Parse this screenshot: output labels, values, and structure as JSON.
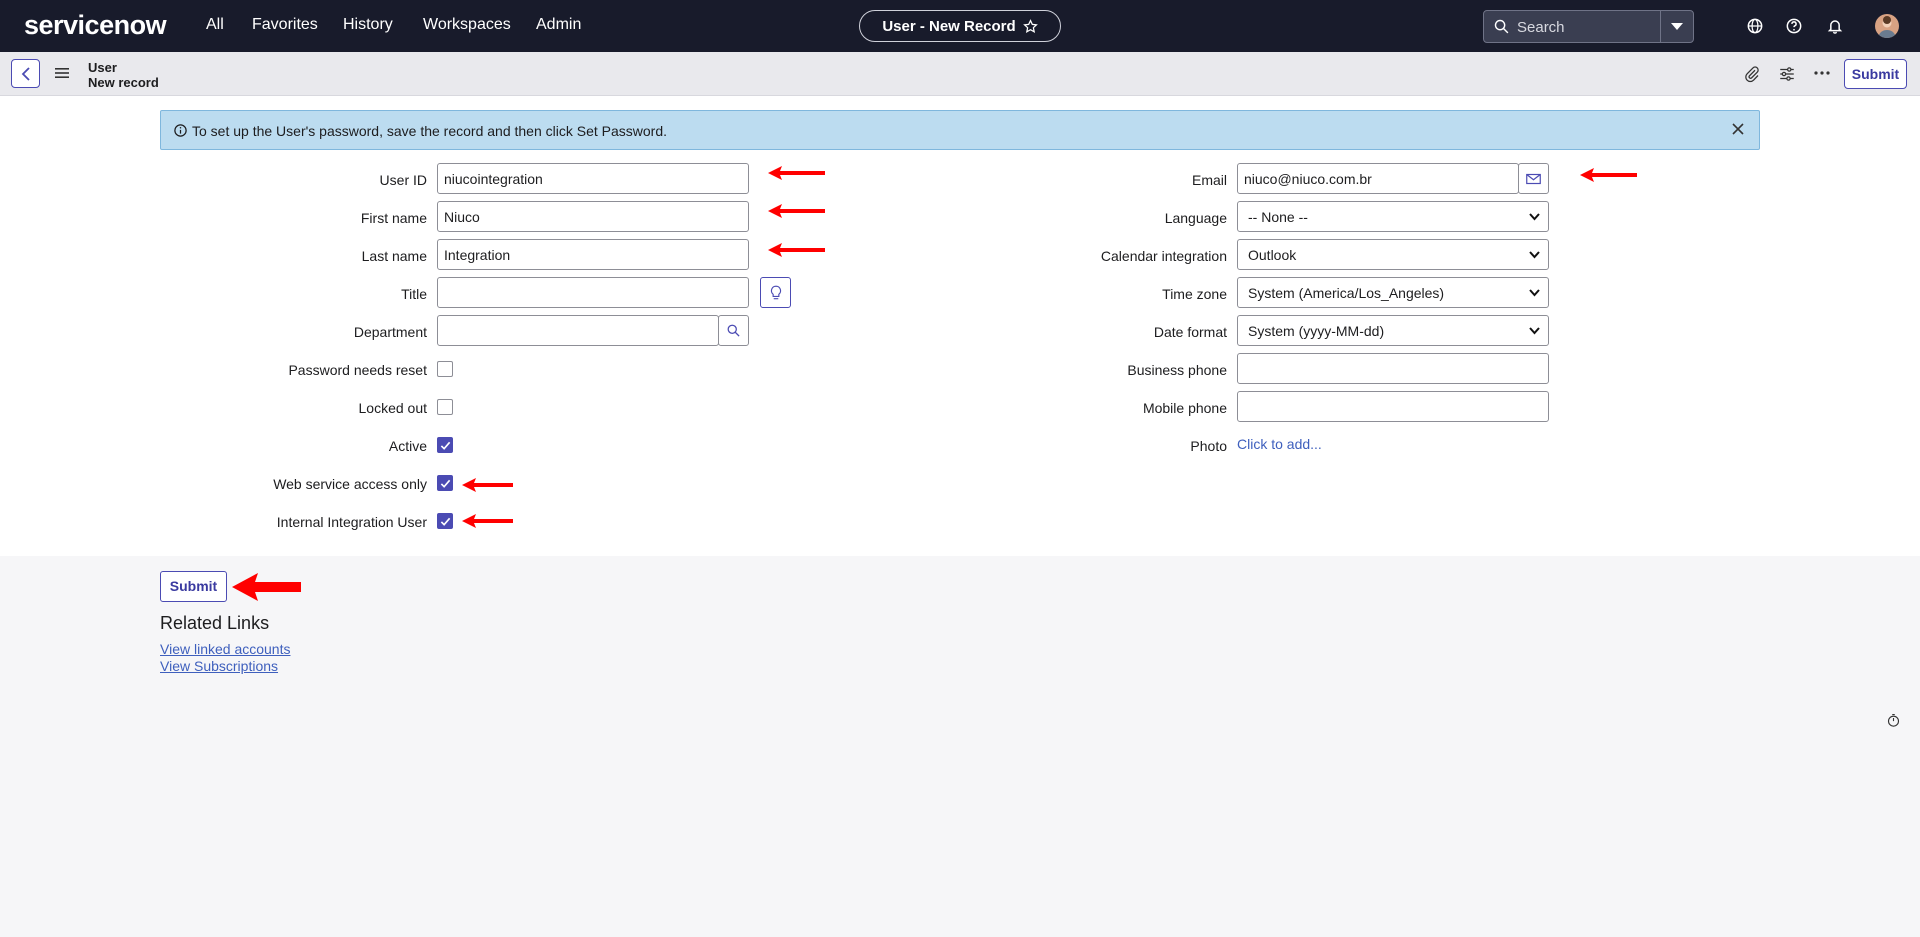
{
  "nav": {
    "logo": "servicenow",
    "links": [
      "All",
      "Favorites",
      "History",
      "Workspaces",
      "Admin"
    ],
    "record_title": "User - New Record",
    "search_placeholder": "Search"
  },
  "header": {
    "table": "User",
    "record": "New record",
    "submit_label": "Submit"
  },
  "info": {
    "message": "To set up the User's password, save the record and then click Set Password."
  },
  "form": {
    "left": {
      "user_id": {
        "label": "User ID",
        "value": "niucointegration"
      },
      "first_name": {
        "label": "First name",
        "value": "Niuco"
      },
      "last_name": {
        "label": "Last name",
        "value": "Integration"
      },
      "title": {
        "label": "Title",
        "value": ""
      },
      "department": {
        "label": "Department",
        "value": ""
      },
      "password_needs_reset": {
        "label": "Password needs reset",
        "checked": false
      },
      "locked_out": {
        "label": "Locked out",
        "checked": false
      },
      "active": {
        "label": "Active",
        "checked": true
      },
      "web_service_only": {
        "label": "Web service access only",
        "checked": true
      },
      "internal_integration": {
        "label": "Internal Integration User",
        "checked": true
      }
    },
    "right": {
      "email": {
        "label": "Email",
        "value": "niuco@niuco.com.br"
      },
      "language": {
        "label": "Language",
        "value": "-- None --"
      },
      "calendar": {
        "label": "Calendar integration",
        "value": "Outlook"
      },
      "time_zone": {
        "label": "Time zone",
        "value": "System (America/Los_Angeles)"
      },
      "date_format": {
        "label": "Date format",
        "value": "System (yyyy-MM-dd)"
      },
      "business_phone": {
        "label": "Business phone",
        "value": ""
      },
      "mobile_phone": {
        "label": "Mobile phone",
        "value": ""
      },
      "photo": {
        "label": "Photo",
        "link": "Click to add..."
      }
    }
  },
  "footer": {
    "submit_label": "Submit",
    "related_title": "Related Links",
    "links": [
      "View linked accounts",
      "View Subscriptions"
    ]
  },
  "colors": {
    "nav_bg": "#181b2b",
    "accent": "#4b4bb3",
    "info_bg": "#bcdcf0",
    "annotation": "#ff0000"
  }
}
